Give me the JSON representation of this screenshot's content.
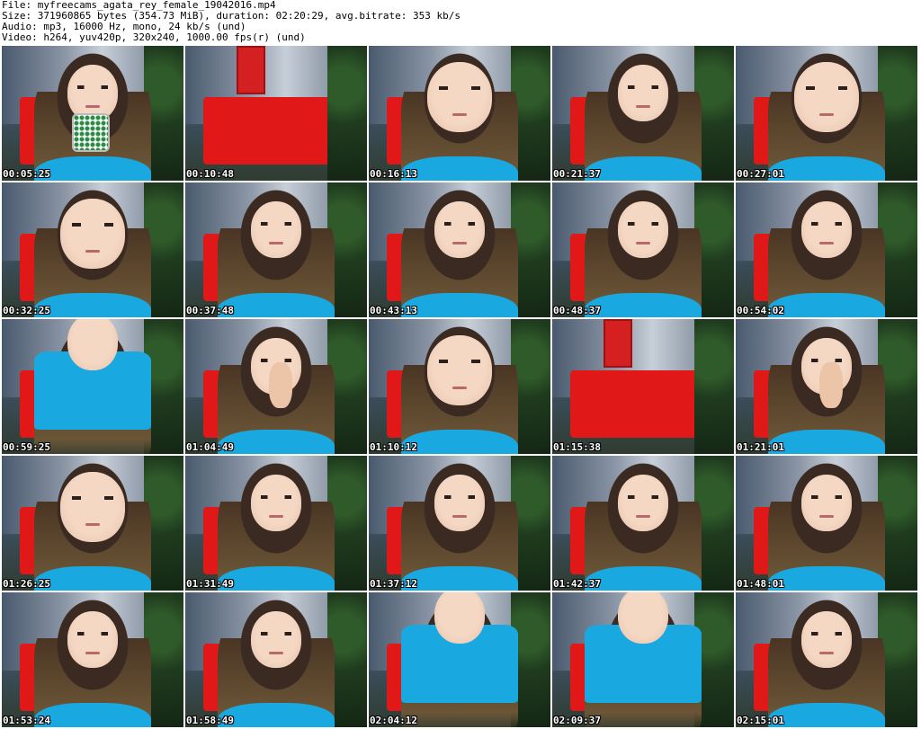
{
  "header": {
    "file_line": "File: myfreecams_agata_rey_female_19042016.mp4",
    "size_line": "Size: 371960865 bytes (354.73 MiB), duration: 02:20:29, avg.bitrate: 353 kb/s",
    "audio_line": "Audio: mp3, 16000 Hz, mono, 24 kb/s (und)",
    "video_line": "Video: h264, yuv420p, 320x240, 1000.00 fps(r) (und)"
  },
  "thumbnails": [
    {
      "timestamp": "00:05:25",
      "variant": "mug"
    },
    {
      "timestamp": "00:10:48",
      "variant": "empty"
    },
    {
      "timestamp": "00:16:13",
      "variant": "closeup"
    },
    {
      "timestamp": "00:21:37",
      "variant": "portrait"
    },
    {
      "timestamp": "00:27:01",
      "variant": "closeup"
    },
    {
      "timestamp": "00:32:25",
      "variant": "closeup"
    },
    {
      "timestamp": "00:37:48",
      "variant": "portrait"
    },
    {
      "timestamp": "00:43:13",
      "variant": "portrait"
    },
    {
      "timestamp": "00:48:37",
      "variant": "portrait"
    },
    {
      "timestamp": "00:54:02",
      "variant": "portrait"
    },
    {
      "timestamp": "00:59:25",
      "variant": "body"
    },
    {
      "timestamp": "01:04:49",
      "variant": "hand"
    },
    {
      "timestamp": "01:10:12",
      "variant": "closeup"
    },
    {
      "timestamp": "01:15:38",
      "variant": "empty"
    },
    {
      "timestamp": "01:21:01",
      "variant": "hand"
    },
    {
      "timestamp": "01:26:25",
      "variant": "closeup"
    },
    {
      "timestamp": "01:31:49",
      "variant": "portrait"
    },
    {
      "timestamp": "01:37:12",
      "variant": "portrait"
    },
    {
      "timestamp": "01:42:37",
      "variant": "portrait"
    },
    {
      "timestamp": "01:48:01",
      "variant": "portrait"
    },
    {
      "timestamp": "01:53:24",
      "variant": "portrait"
    },
    {
      "timestamp": "01:58:49",
      "variant": "portrait"
    },
    {
      "timestamp": "02:04:12",
      "variant": "body"
    },
    {
      "timestamp": "02:09:37",
      "variant": "body"
    },
    {
      "timestamp": "02:15:01",
      "variant": "portrait"
    }
  ]
}
